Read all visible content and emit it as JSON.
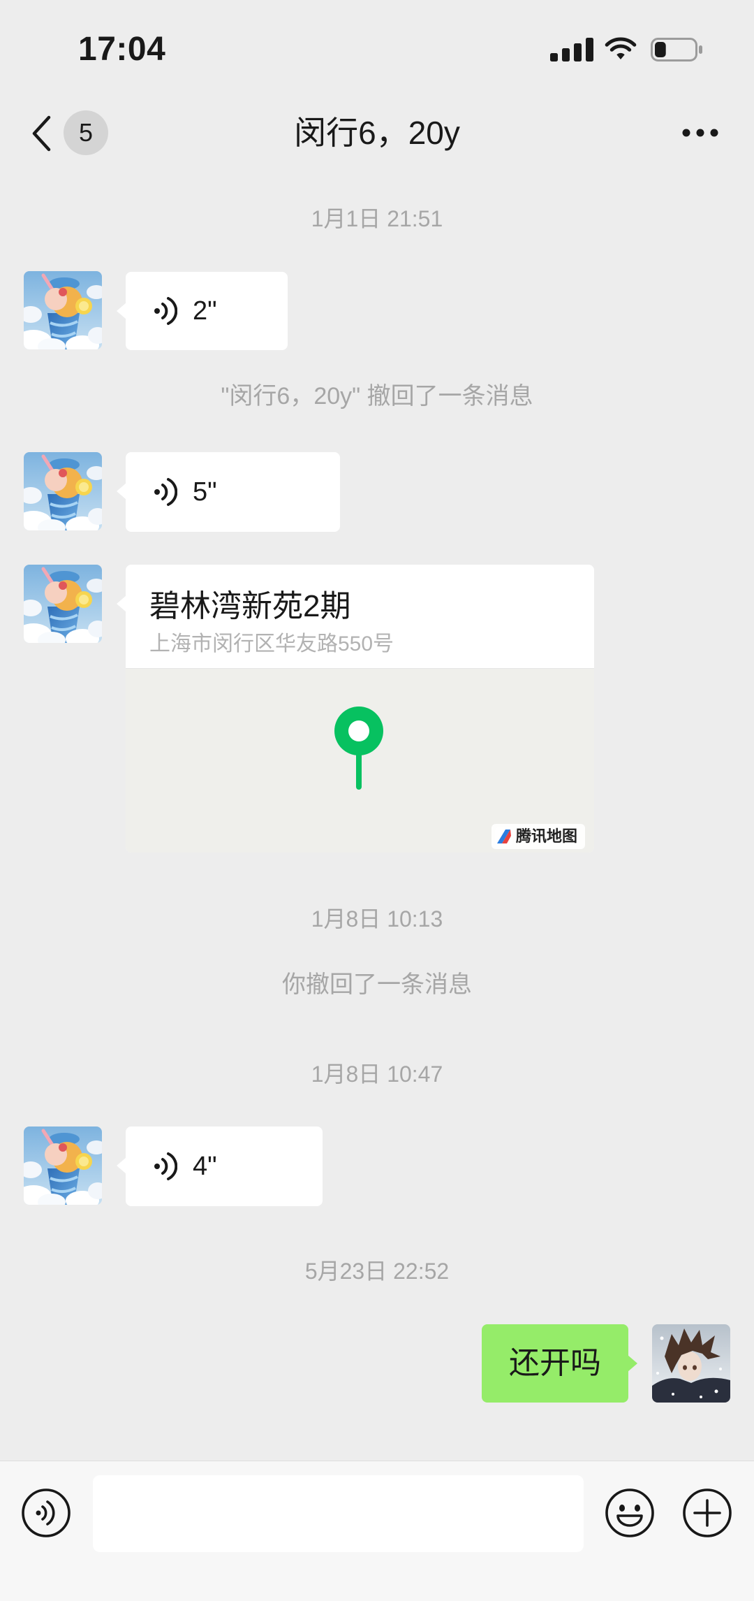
{
  "status_bar": {
    "time": "17:04",
    "battery_level": 0.28,
    "signal_icon": "signal-bars-icon",
    "wifi_icon": "wifi-icon",
    "battery_icon": "battery-icon"
  },
  "header": {
    "back_icon": "chevron-left-icon",
    "unread_count": "5",
    "title": "闵行6，20y",
    "more_icon": "more-dots-icon"
  },
  "chat": {
    "items": [
      {
        "time": "1月1日 21:51"
      },
      {
        "voice_duration": "2\"",
        "icon": "voice-wave-icon"
      },
      {
        "notice": "\"闵行6，20y\" 撤回了一条消息"
      },
      {
        "voice_duration": "5\"",
        "icon": "voice-wave-icon"
      },
      {
        "location_name": "碧林湾新苑2期",
        "location_address": "上海市闵行区华友路550号",
        "map_provider": "腾讯地图",
        "icon": "map-pin-icon"
      },
      {
        "time": "1月8日 10:13"
      },
      {
        "notice": "你撤回了一条消息"
      },
      {
        "time": "1月8日 10:47"
      },
      {
        "voice_duration": "4\"",
        "icon": "voice-wave-icon"
      },
      {
        "time": "5月23日 22:52"
      },
      {
        "outgoing_text": "还开吗"
      }
    ]
  },
  "input_bar": {
    "value": "",
    "voice_icon": "voice-mode-icon",
    "emoji_icon": "emoji-icon",
    "plus_icon": "plus-circle-icon"
  },
  "colors": {
    "background": "#ededed",
    "incoming_bubble": "#ffffff",
    "outgoing_bubble": "#95ec69",
    "map_pin": "#07c160",
    "meta_text": "#a6a6a6"
  }
}
